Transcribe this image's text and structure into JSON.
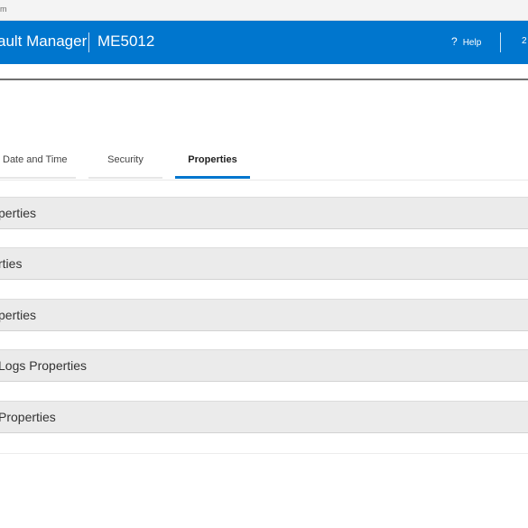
{
  "browser": {
    "url_fragment": "m"
  },
  "header": {
    "app_title": "ault Manager",
    "system_name": "ME5012",
    "help_icon": "?",
    "help_label": "Help",
    "user_fragment": "2"
  },
  "tabs": [
    {
      "label": "Date and Time",
      "active": false
    },
    {
      "label": "Security",
      "active": false
    },
    {
      "label": "Properties",
      "active": true
    }
  ],
  "sections": [
    {
      "title": "perties"
    },
    {
      "title": "rties"
    },
    {
      "title": "perties"
    },
    {
      "title": "Logs Properties"
    },
    {
      "title": "Properties"
    }
  ],
  "colors": {
    "header_bg": "#0076ce",
    "active_tab_underline": "#0076ce",
    "section_bg": "#ebebeb"
  }
}
